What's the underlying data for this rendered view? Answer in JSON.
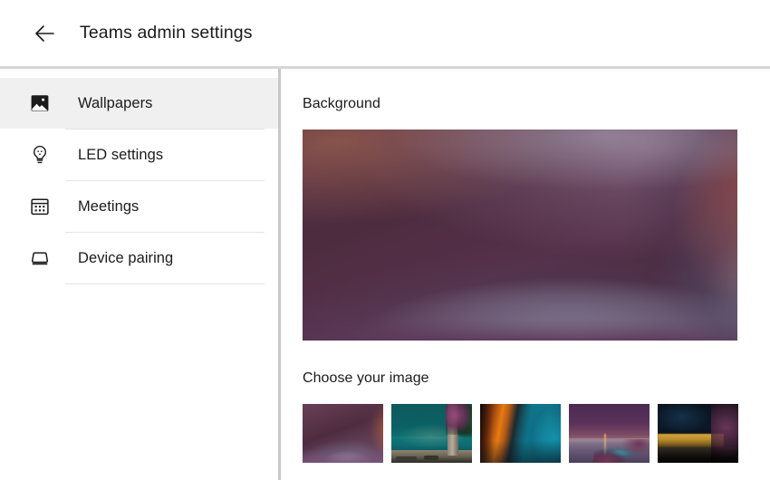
{
  "header": {
    "back_icon": "arrow-left-icon",
    "title": "Teams admin settings"
  },
  "sidebar": {
    "items": [
      {
        "label": "Wallpapers",
        "icon": "image-icon",
        "selected": true
      },
      {
        "label": "LED settings",
        "icon": "lightbulb-icon",
        "selected": false
      },
      {
        "label": "Meetings",
        "icon": "calendar-icon",
        "selected": false
      },
      {
        "label": "Device pairing",
        "icon": "monitor-icon",
        "selected": false
      }
    ]
  },
  "main": {
    "background_label": "Background",
    "choose_label": "Choose your image",
    "hero": {
      "name": "abstract-purple-orange-wave",
      "selected": true
    },
    "thumbnails": [
      {
        "name": "abstract-purple-orange-wave",
        "selected": true
      },
      {
        "name": "teal-sea-dusk-tree",
        "selected": false
      },
      {
        "name": "orange-teal-abstract-curve",
        "selected": false
      },
      {
        "name": "purple-dusk-winding-causeway",
        "selected": false
      },
      {
        "name": "night-golden-wall-foliage",
        "selected": false
      }
    ]
  },
  "colors": {
    "page_background": "#ffffff",
    "text": "#1b1b1b",
    "selected_row": "#f0f0f0",
    "divider": "#e4e4e4",
    "header_border": "#d6d6d6",
    "vertical_divider": "#c8c8c8"
  }
}
